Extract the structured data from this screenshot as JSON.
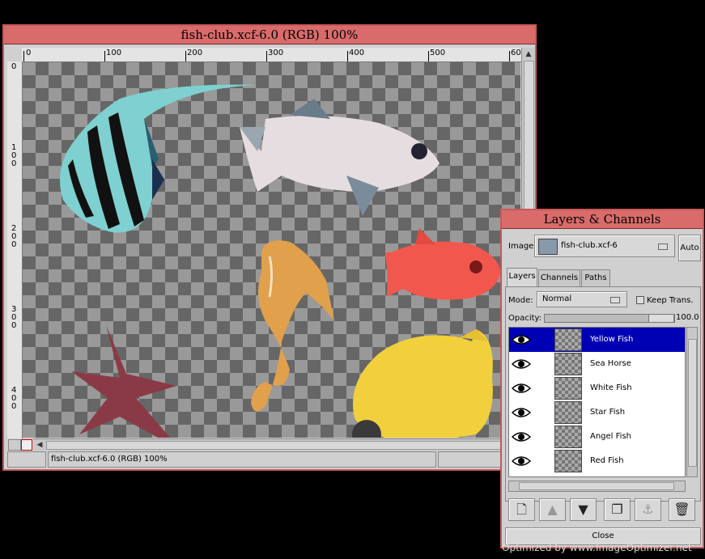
{
  "image_window": {
    "title": "fish-club.xcf-6.0 (RGB) 100%",
    "status_text": "fish-club.xcf-6.0 (RGB) 100%",
    "hruler_labels": [
      "0",
      "100",
      "200",
      "300",
      "400",
      "500",
      "60"
    ],
    "vruler_labels": [
      "0",
      "1\n0\n0",
      "2\n0\n0",
      "3\n0\n0",
      "4\n0\n0"
    ]
  },
  "layers_dialog": {
    "title": "Layers & Channels",
    "image_label": "Image:",
    "image_value": "fish-club.xcf-6",
    "auto_label": "Auto",
    "tabs": [
      {
        "label": "Layers"
      },
      {
        "label": "Channels"
      },
      {
        "label": "Paths"
      }
    ],
    "mode_label": "Mode:",
    "mode_value": "Normal",
    "keep_trans_label": "Keep Trans.",
    "opacity_label": "Opacity:",
    "opacity_value": "100.0",
    "layers": [
      {
        "name": "Yellow Fish",
        "selected": true
      },
      {
        "name": "Sea Horse"
      },
      {
        "name": "White Fish"
      },
      {
        "name": "Star Fish"
      },
      {
        "name": "Angel Fish"
      },
      {
        "name": "Red Fish"
      }
    ],
    "toolbar_icons": [
      "new-layer-icon",
      "raise-layer-icon",
      "lower-layer-icon",
      "duplicate-layer-icon",
      "anchor-layer-icon",
      "delete-layer-icon"
    ],
    "close_label": "Close"
  },
  "watermark": "Optimized by www.ImageOptimizer.net",
  "colors": {
    "title_bar": "#d96b6b",
    "selection": "#0000b4",
    "yellow_fish": "#f2cf3c",
    "red_fish": "#f2574e"
  }
}
